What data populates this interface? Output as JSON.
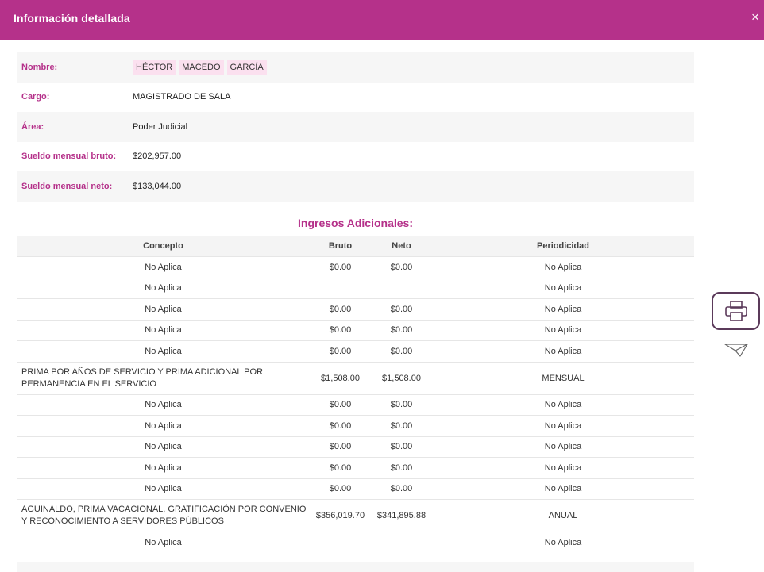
{
  "header": {
    "title": "Información detallada",
    "close": "×"
  },
  "info": {
    "nombre_label": "Nombre:",
    "nombre_parts": [
      "HÉCTOR",
      "MACEDO",
      "GARCÍA"
    ],
    "cargo_label": "Cargo:",
    "cargo": "MAGISTRADO DE SALA",
    "area_label": "Área:",
    "area": "Poder Judicial",
    "bruto_label": "Sueldo mensual bruto:",
    "bruto": "$202,957.00",
    "neto_label": "Sueldo mensual neto:",
    "neto": "$133,044.00"
  },
  "ingresos": {
    "title": "Ingresos Adicionales:",
    "columns": [
      "Concepto",
      "Bruto",
      "Neto",
      "Periodicidad"
    ],
    "rows": [
      [
        "No Aplica",
        "$0.00",
        "$0.00",
        "No Aplica"
      ],
      [
        "No Aplica",
        "",
        "",
        "No Aplica"
      ],
      [
        "No Aplica",
        "$0.00",
        "$0.00",
        "No Aplica"
      ],
      [
        "No Aplica",
        "$0.00",
        "$0.00",
        "No Aplica"
      ],
      [
        "No Aplica",
        "$0.00",
        "$0.00",
        "No Aplica"
      ],
      [
        "PRIMA POR AÑOS DE SERVICIO Y PRIMA ADICIONAL POR PERMANENCIA EN EL SERVICIO",
        "$1,508.00",
        "$1,508.00",
        "MENSUAL"
      ],
      [
        "No Aplica",
        "$0.00",
        "$0.00",
        "No Aplica"
      ],
      [
        "No Aplica",
        "$0.00",
        "$0.00",
        "No Aplica"
      ],
      [
        "No Aplica",
        "$0.00",
        "$0.00",
        "No Aplica"
      ],
      [
        "No Aplica",
        "$0.00",
        "$0.00",
        "No Aplica"
      ],
      [
        "No Aplica",
        "$0.00",
        "$0.00",
        "No Aplica"
      ],
      [
        "AGUINALDO, PRIMA VACACIONAL, GRATIFICACIÓN POR CONVENIO Y RECONOCIMIENTO A SERVIDORES PÚBLICOS",
        "$356,019.70",
        "$341,895.88",
        "ANUAL"
      ],
      [
        "No Aplica",
        "",
        "",
        "No Aplica"
      ]
    ]
  },
  "actions": {
    "print_icon": "printer-icon",
    "send_icon": "paper-plane-icon"
  },
  "colors": {
    "brand": "#b5318a",
    "chip": "#fbe0ef",
    "band": "#f6f6f6"
  }
}
